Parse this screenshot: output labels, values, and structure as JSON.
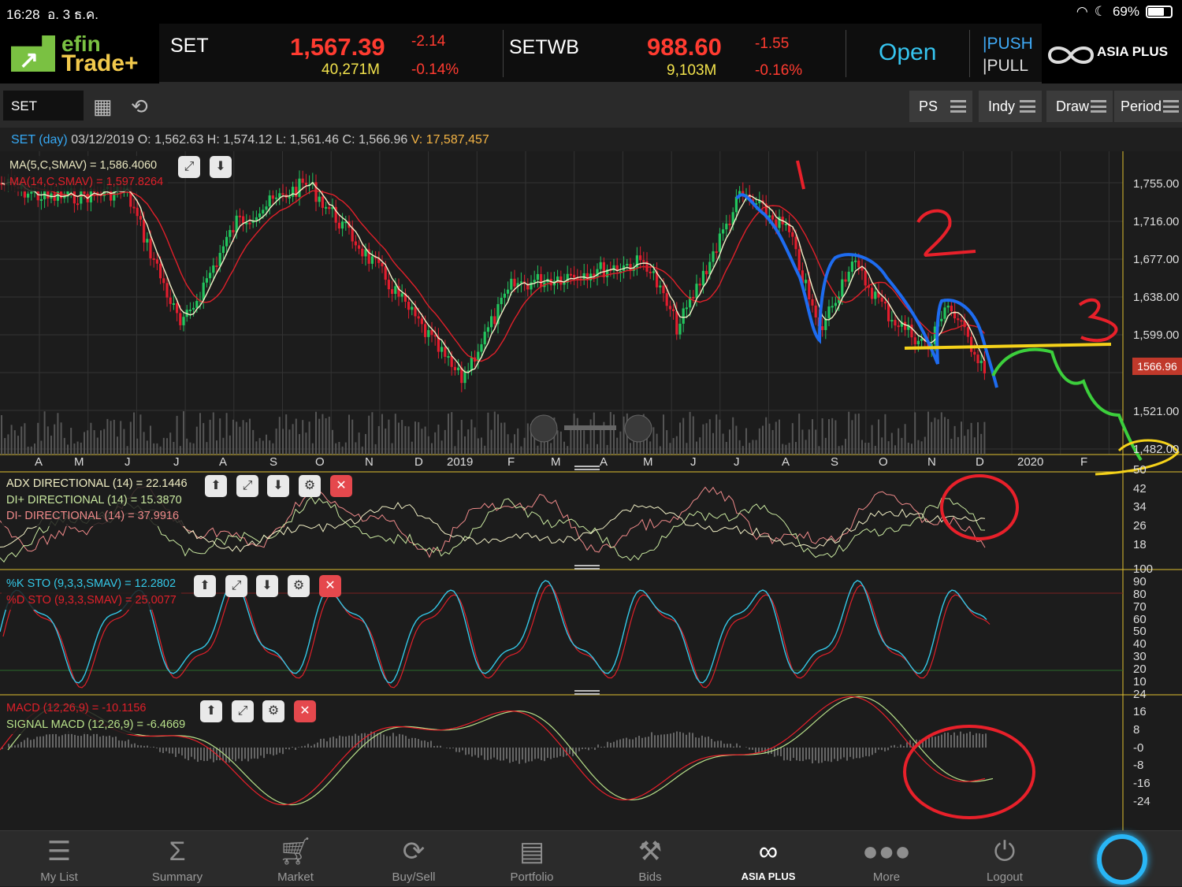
{
  "status": {
    "time": "16:28",
    "date": "อ. 3 ธ.ค.",
    "battery": "69%"
  },
  "quotes": [
    {
      "name": "SET",
      "price": "1,567.39",
      "change": "-2.14",
      "volume": "40,271M",
      "pct": "-0.14%"
    },
    {
      "name": "SETWB",
      "price": "988.60",
      "change": "-1.55",
      "volume": "9,103M",
      "pct": "-0.16%"
    }
  ],
  "market_state": "Open",
  "push": "PUSH",
  "pull": "PULL",
  "brand": {
    "app_a": "efin",
    "app_b": "Trade+",
    "broker": "ASIA PLUS"
  },
  "toolbar": {
    "symbol": "SET",
    "buttons": [
      "PS",
      "Indy",
      "Draw",
      "Period"
    ]
  },
  "ohlc": {
    "sym": "SET (day)",
    "date": "03/12/2019",
    "o_l": "O:",
    "o": "1,562.63",
    "h_l": "H:",
    "h": "1,574.12",
    "l_l": "L:",
    "l": "1,561.46",
    "c_l": "C:",
    "c": "1,566.96",
    "v_l": "V:",
    "v": "17,587,457"
  },
  "price_legend": {
    "ma5": "MA(5,C,SMAV) = 1,586.4060",
    "ma14": "MA(14,C,SMAV) = 1,597.8264"
  },
  "price_axis": [
    "1,755.00",
    "1,716.00",
    "1,677.00",
    "1,638.00",
    "1,599.00",
    "1,521.00",
    "1,482.00"
  ],
  "last_price": "1566.96",
  "x_axis": [
    "A",
    "M",
    "J",
    "J",
    "A",
    "S",
    "O",
    "N",
    "D",
    "2019",
    "F",
    "M",
    "A",
    "M",
    "J",
    "J",
    "A",
    "S",
    "O",
    "N",
    "D",
    "2020",
    "F"
  ],
  "adx_legend": {
    "adx": "ADX DIRECTIONAL (14) = 22.1446",
    "dip": "DI+ DIRECTIONAL (14) = 15.3870",
    "dim": "DI- DIRECTIONAL (14) = 37.9916"
  },
  "adx_axis": [
    "50",
    "42",
    "34",
    "26",
    "18"
  ],
  "sto_legend": {
    "k": "%K STO (9,3,3,SMAV) = 12.2802",
    "d": "%D STO (9,3,3,SMAV) = 25.0077"
  },
  "sto_axis": [
    "100",
    "90",
    "80",
    "70",
    "60",
    "50",
    "40",
    "30",
    "20",
    "10"
  ],
  "macd_legend": {
    "macd": "MACD (12,26,9) = -10.1156",
    "signal": "SIGNAL MACD (12,26,9) = -6.4669"
  },
  "macd_axis": [
    "24",
    "16",
    "8",
    "-0",
    "-8",
    "-16",
    "-24"
  ],
  "annotations": [
    "1",
    "2",
    "3"
  ],
  "nav": [
    {
      "label": "My List",
      "icon": "list-icon"
    },
    {
      "label": "Summary",
      "icon": "sigma-icon"
    },
    {
      "label": "Market",
      "icon": "cart-icon"
    },
    {
      "label": "Buy/Sell",
      "icon": "buysell-icon"
    },
    {
      "label": "Portfolio",
      "icon": "portfolio-icon"
    },
    {
      "label": "Bids",
      "icon": "gavel-icon"
    },
    {
      "label": "ASIA PLUS",
      "icon": "asiaplus-logo"
    },
    {
      "label": "More",
      "icon": "more-icon"
    },
    {
      "label": "Logout",
      "icon": "power-icon"
    }
  ],
  "colors": {
    "bull": "#22c55e",
    "bear": "#e11d2e",
    "ma5": "#f3f0c8",
    "ma14": "#e0202a",
    "sto_k": "#34c8e8",
    "sto_d": "#e0202a",
    "drawing_blue": "#1e6cf0",
    "drawing_green": "#3ccf3c",
    "drawing_yellow": "#f5d21a",
    "drawing_red": "#e8202a"
  }
}
